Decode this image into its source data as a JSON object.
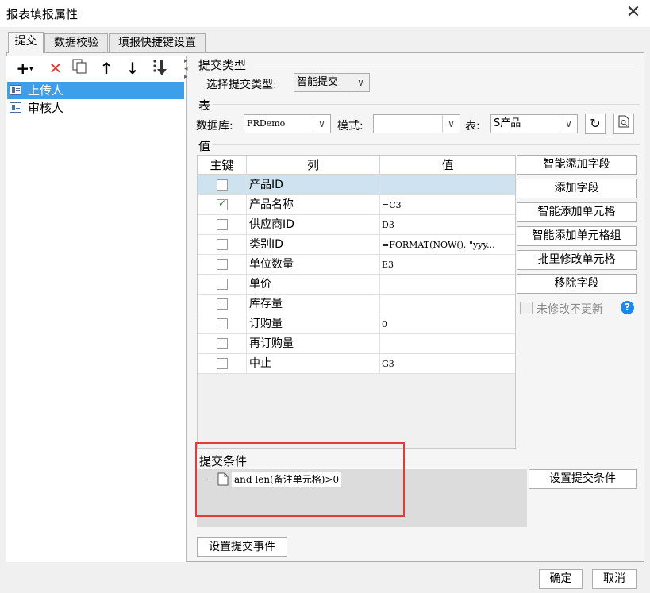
{
  "window": {
    "title": "报表填报属性",
    "close_icon": "close-icon"
  },
  "tabs": [
    "提交",
    "数据校验",
    "填报快捷键设置"
  ],
  "left_toolbar": {
    "add_icon": "plus-icon",
    "delete_icon": "red-x-icon",
    "copy_icon": "copy-icon",
    "up_icon": "arrow-up-icon",
    "down_icon": "arrow-down-icon",
    "sort_icon": "sort-down-icon"
  },
  "tree_items": [
    {
      "label": "上传人",
      "selected": true
    },
    {
      "label": "审核人",
      "selected": false
    }
  ],
  "submit_type": {
    "section": "提交类型",
    "label": "选择提交类型:",
    "value": "智能提交"
  },
  "table_section": {
    "section": "表",
    "db_label": "数据库:",
    "db_value": "FRDemo",
    "mode_label": "模式:",
    "mode_value": "",
    "table_label": "表:",
    "table_value": "S产品"
  },
  "value_section": {
    "section": "值",
    "columns": [
      "主键",
      "列",
      "值"
    ],
    "rows": [
      {
        "key": false,
        "col": "产品ID",
        "val": ""
      },
      {
        "key": true,
        "col": "产品名称",
        "val": "=C3"
      },
      {
        "key": false,
        "col": "供应商ID",
        "val": "D3"
      },
      {
        "key": false,
        "col": "类别ID",
        "val": "=FORMAT(NOW(), \"yyy..."
      },
      {
        "key": false,
        "col": "单位数量",
        "val": "E3"
      },
      {
        "key": false,
        "col": "单价",
        "val": ""
      },
      {
        "key": false,
        "col": "库存量",
        "val": ""
      },
      {
        "key": false,
        "col": "订购量",
        "val": "0"
      },
      {
        "key": false,
        "col": "再订购量",
        "val": ""
      },
      {
        "key": false,
        "col": "中止",
        "val": "G3"
      }
    ]
  },
  "side_buttons": [
    "智能添加字段",
    "添加字段",
    "智能添加单元格",
    "智能添加单元格组",
    "批里修改单元格",
    "移除字段"
  ],
  "no_update_checkbox": {
    "label": "未修改不更新",
    "checked": false
  },
  "condition": {
    "section": "提交条件",
    "expression": "and len(备注单元格)>0",
    "button": "设置提交条件"
  },
  "submit_event_button": "设置提交事件",
  "footer": {
    "ok": "确定",
    "cancel": "取消"
  },
  "colors": {
    "selection": "#3d9ee9",
    "row_highlight": "#cfe2f0",
    "delete": "#e53935",
    "highlight_box": "#e23b3b",
    "help": "#1e88e5"
  }
}
